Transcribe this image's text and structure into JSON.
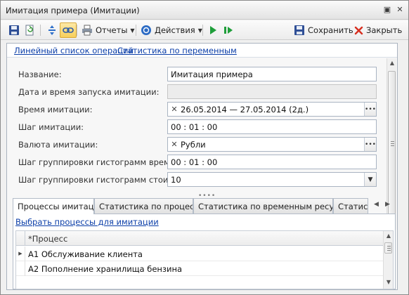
{
  "window": {
    "title": "Имитация примера (Имитации)"
  },
  "toolbar": {
    "reports_label": "Отчеты",
    "actions_label": "Действия",
    "save_label": "Сохранить",
    "close_label": "Закрыть"
  },
  "links": {
    "operations": "Линейный список операций",
    "variables": "Статистика по переменным"
  },
  "form": {
    "name": {
      "label": "Название:",
      "value": "Имитация примера"
    },
    "launch": {
      "label": "Дата и время запуска имитации:",
      "value": ""
    },
    "period": {
      "label": "Время имитации:",
      "value": "26.05.2014 — 27.05.2014 (2д.)"
    },
    "step": {
      "label": "Шаг имитации:",
      "value": "00 : 01 : 00"
    },
    "currency": {
      "label": "Валюта имитации:",
      "value": "Рубли"
    },
    "hist_time": {
      "label": "Шаг группировки гистограмм времени:",
      "value": "00 : 01 : 00"
    },
    "hist_cost": {
      "label": "Шаг группировки гистограмм стоимости:",
      "value": "10"
    }
  },
  "tabs": [
    {
      "label": "Процессы имитации",
      "active": true
    },
    {
      "label": "Статистика по процессам",
      "active": false
    },
    {
      "label": "Статистика по временным ресурсам",
      "active": false
    },
    {
      "label": "Статистика",
      "active": false
    }
  ],
  "processes": {
    "select_link": "Выбрать процессы для имитации",
    "column": "*Процесс",
    "rows": [
      "А1 Обслуживание клиента",
      "А2 Пополнение хранилища бензина"
    ]
  },
  "colors": {
    "accent_link": "#0b3ea8",
    "active_toolbar_button": "#f7cf5a",
    "save_icon": "#2f4f96",
    "close_icon": "#d62e1f",
    "play_icon": "#1f9e3a"
  }
}
